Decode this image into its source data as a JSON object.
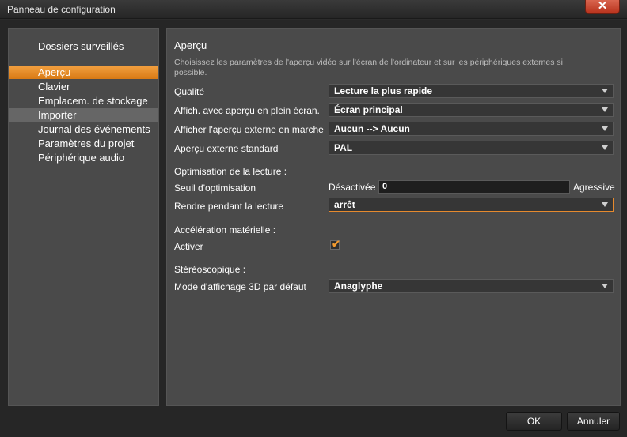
{
  "window": {
    "title": "Panneau de configuration"
  },
  "sidebar": {
    "heading": "Dossiers surveillés",
    "items": [
      {
        "label": "Aperçu"
      },
      {
        "label": "Clavier"
      },
      {
        "label": "Emplacem. de stockage"
      },
      {
        "label": "Importer"
      },
      {
        "label": "Journal des événements"
      },
      {
        "label": "Paramètres du projet"
      },
      {
        "label": "Périphérique audio"
      }
    ]
  },
  "main": {
    "title": "Aperçu",
    "description": "Choisissez les paramètres de l'aperçu vidéo sur l'écran de l'ordinateur et sur les périphériques externes si possible.",
    "quality": {
      "label": "Qualité",
      "value": "Lecture la plus rapide"
    },
    "fullscreen": {
      "label": "Affich. avec aperçu en plein écran.",
      "value": "Écran principal"
    },
    "external_preview": {
      "label": "Afficher l'aperçu externe en marche",
      "value": "Aucun --> Aucun"
    },
    "external_standard": {
      "label": "Aperçu externe standard",
      "value": "PAL"
    },
    "optimization_heading": "Optimisation de la lecture :",
    "threshold": {
      "label": "Seuil d'optimisation",
      "min_label": "Désactivée",
      "max_label": "Agressive",
      "value": "0"
    },
    "render_playback": {
      "label": "Rendre pendant la lecture",
      "value": "arrêt"
    },
    "hw_accel_heading": "Accélération matérielle :",
    "activate": {
      "label": "Activer",
      "checked": true
    },
    "stereo_heading": "Stéréoscopique :",
    "mode3d": {
      "label": "Mode d'affichage 3D par défaut",
      "value": "Anaglyphe"
    }
  },
  "footer": {
    "ok_label": "OK",
    "cancel_label": "Annuler"
  },
  "colors": {
    "accent": "#e68a2e",
    "panel": "#4a4a4a",
    "close": "#c9452c"
  }
}
